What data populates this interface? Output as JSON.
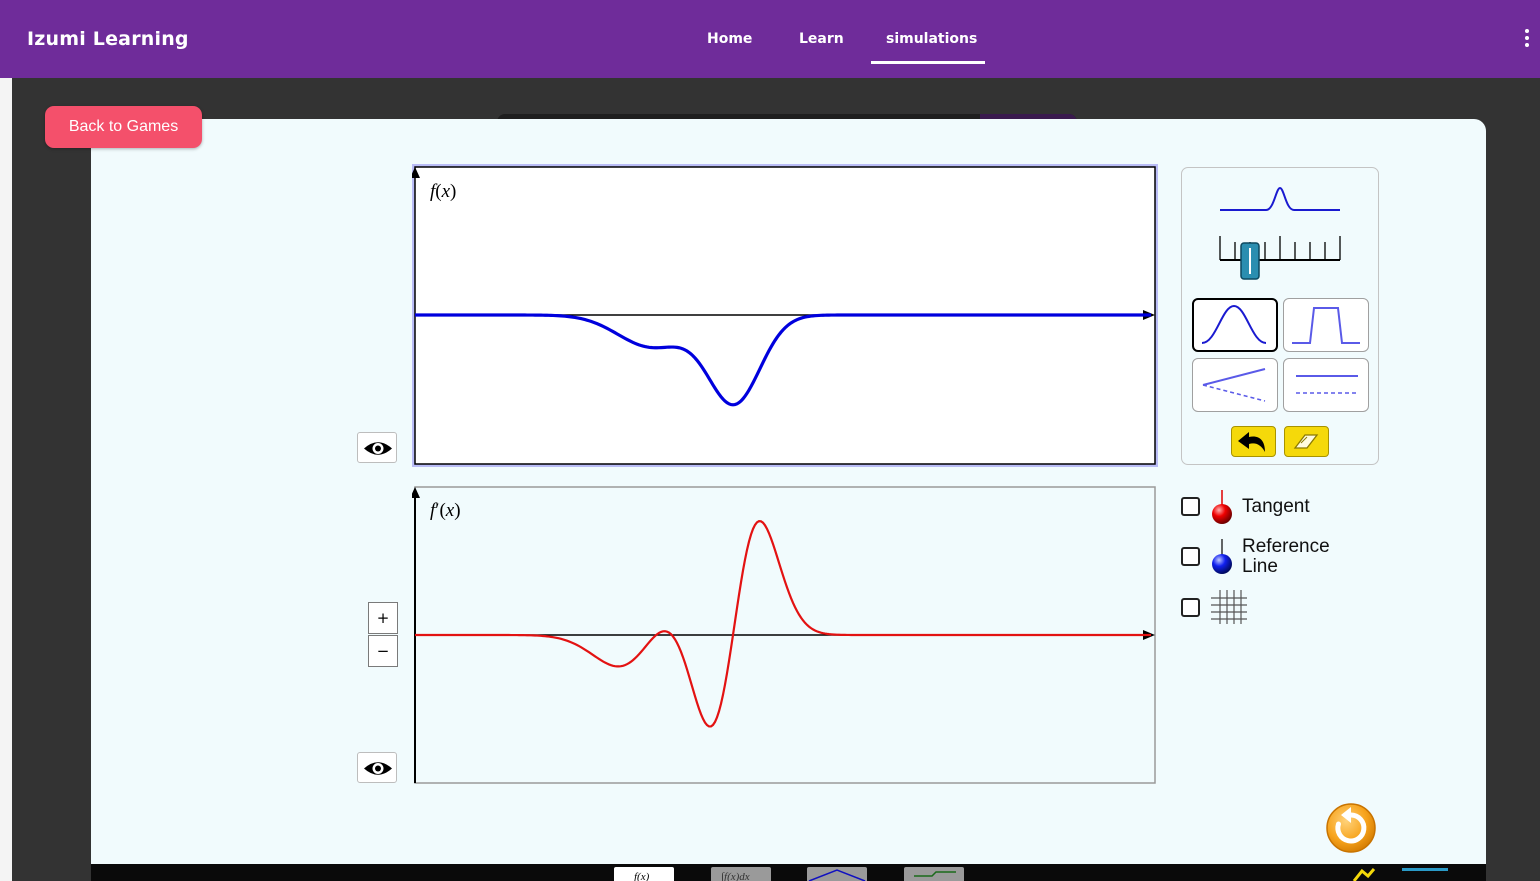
{
  "navbar": {
    "brand": "Izumi Learning",
    "links": [
      {
        "label": "Home"
      },
      {
        "label": "Learn"
      },
      {
        "label": "simulations",
        "active": true
      }
    ],
    "menu_icon": "kebab-vertical-icon"
  },
  "back_button": {
    "label": "Back to Games"
  },
  "graphs": {
    "top": {
      "ylabel_f": "f",
      "ylabel_x": "x",
      "curve_color": "#0000dd"
    },
    "bottom": {
      "ylabel_f": "f",
      "ylabel_prime": "′",
      "ylabel_x": "x",
      "curve_color": "#e31212"
    }
  },
  "zoom": {
    "in_label": "+",
    "out_label": "−"
  },
  "controls": {
    "shape_buttons": [
      {
        "name": "gaussian-peak",
        "selected": true
      },
      {
        "name": "square-pulse",
        "selected": false
      },
      {
        "name": "sloped-line",
        "selected": false
      },
      {
        "name": "flat-line",
        "selected": false
      }
    ],
    "width_slider": {
      "ticks": 9,
      "value_fraction": 0.25
    },
    "tools": [
      {
        "icon": "undo-arrow-icon"
      },
      {
        "icon": "eraser-icon"
      }
    ]
  },
  "options": [
    {
      "label": "Tangent",
      "checked": false,
      "ball_color": "#e00000"
    },
    {
      "label_line1": "Reference",
      "label_line2": "Line",
      "checked": false,
      "ball_color": "#1020e0"
    },
    {
      "checked": false,
      "icon": "grid-icon"
    }
  ],
  "colors": {
    "navbar": "#6f2c9a",
    "back_button": "#f4506b",
    "panel_bg": "#f1fbfd",
    "tool_yellow": "#f5d90a",
    "reset_orange": "#f7a31c"
  },
  "bottom_tabs": [
    {
      "label": "f(x)"
    },
    {
      "label": "∫f(x)dx"
    }
  ]
}
